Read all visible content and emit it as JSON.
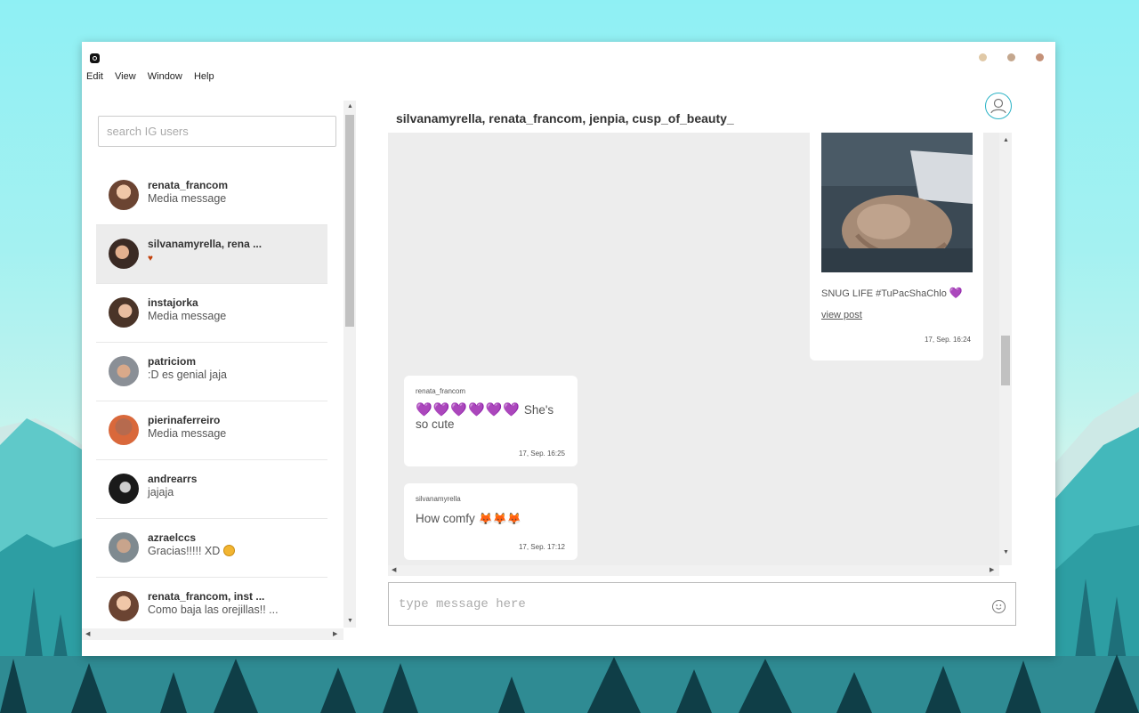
{
  "menu": [
    "Edit",
    "View",
    "Window",
    "Help"
  ],
  "window_controls": {
    "colors": [
      "#e0c9a7",
      "#c4a78e",
      "#c49178"
    ]
  },
  "search": {
    "placeholder": "search IG users",
    "value": ""
  },
  "conversations": [
    {
      "name": "renata_francom",
      "preview": "Media message"
    },
    {
      "name": "silvanamyrella, rena ...",
      "preview": "",
      "preview_icon": "heart-emoji",
      "selected": true
    },
    {
      "name": "instajorka",
      "preview": "Media message"
    },
    {
      "name": "patriciom",
      "preview": ":D es genial jaja"
    },
    {
      "name": "pierinaferreiro",
      "preview": "Media message"
    },
    {
      "name": "andrearrs",
      "preview": "jajaja"
    },
    {
      "name": "azraelccs",
      "preview": "Gracias!!!!! XD",
      "preview_icon": "smile-emoji"
    },
    {
      "name": "renata_francom, inst ...",
      "preview": "Como baja las orejillas!! ..."
    }
  ],
  "chat": {
    "title": "silvanamyrella, renata_francom, jenpia, cusp_of_beauty_",
    "post": {
      "caption": "SNUG LIFE #TuPacShaChlo",
      "caption_icon": "purple-heart-emoji",
      "link": "view post",
      "time": "17, Sep. 16:24"
    },
    "messages": [
      {
        "sender": "renata_francom",
        "emoji": "💜💜💜💜💜💜",
        "text_line1": "She's",
        "text_line2": "so cute",
        "time": "17, Sep. 16:25"
      },
      {
        "sender": "silvanamyrella",
        "text": "How comfy",
        "emoji": "🦊🦊🦊",
        "time": "17, Sep. 17:12"
      }
    ]
  },
  "composer": {
    "placeholder": "type message here",
    "value": ""
  },
  "colors": {
    "accent": "#2bb3c6",
    "selected_row": "#ececec",
    "chat_bg": "#ededed",
    "heart": "#7c4dd1"
  }
}
